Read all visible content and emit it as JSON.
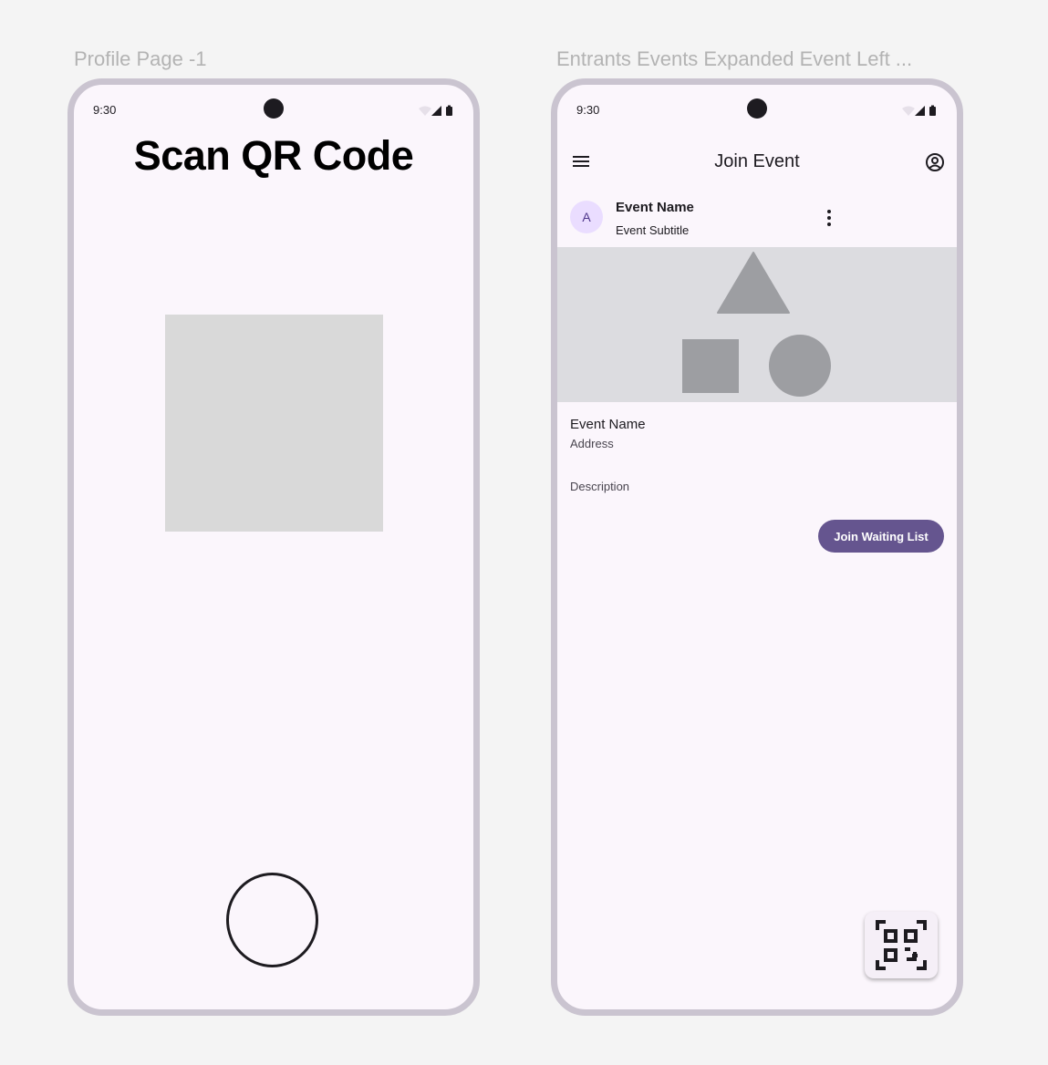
{
  "frames": {
    "left_label": "Profile Page -1",
    "right_label": "Entrants Events Expanded Event Left ..."
  },
  "left_phone": {
    "status_time": "9:30",
    "title": "Scan QR Code"
  },
  "right_phone": {
    "status_time": "9:30",
    "topbar_title": "Join Event",
    "card": {
      "avatar_letter": "A",
      "title": "Event Name",
      "subtitle": "Event Subtitle"
    },
    "event_name": "Event Name",
    "address": "Address",
    "description": "Description",
    "join_button": "Join Waiting List"
  },
  "icons": {
    "status": [
      "wifi-icon",
      "cellular-icon",
      "battery-icon"
    ],
    "topbar": [
      "menu-icon",
      "account-circle-icon"
    ],
    "card": [
      "more-vert-icon"
    ],
    "fab": "qr-code-icon"
  },
  "colors": {
    "background": "#f4f4f4",
    "phone_frame": "#cac4d0",
    "screen": "#fbf6fc",
    "primary": "#65558f",
    "avatar_bg": "#eaddff",
    "placeholder": "#d9d9d9",
    "media_bg": "#dcdce0",
    "media_shapes": "#9d9ea2"
  }
}
